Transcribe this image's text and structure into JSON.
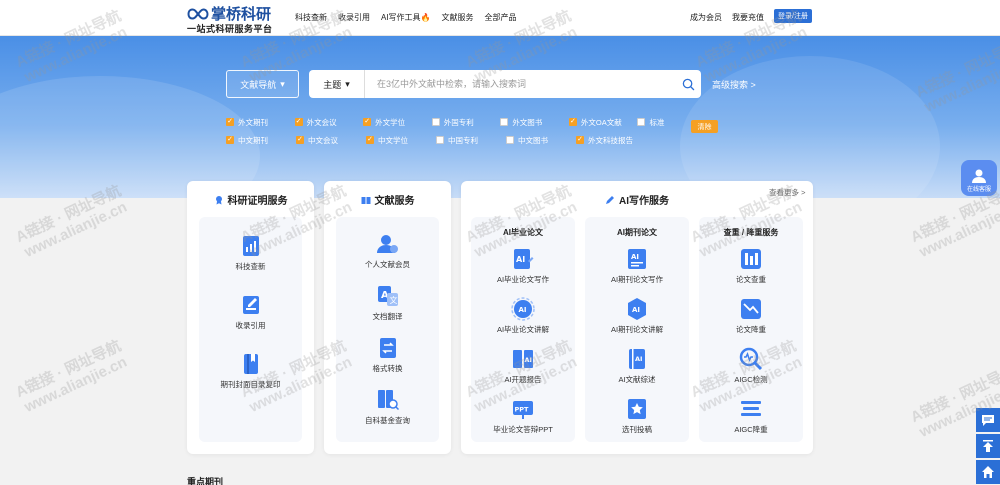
{
  "brand": {
    "name": "掌桥科研",
    "tagline": "一站式科研服务平台"
  },
  "nav": {
    "items": [
      "科技查新",
      "收录引用",
      "AI写作工具",
      "文献服务",
      "全部产品"
    ]
  },
  "top_right": {
    "member": "成为会员",
    "recharge": "我要充值",
    "login": "登录/注册"
  },
  "search": {
    "nav_select": "文献导航",
    "type_select": "主题",
    "placeholder": "在3亿中外文献中检索，请输入搜索词",
    "advanced": "高级搜索 >"
  },
  "filters": {
    "row1": [
      {
        "label": "外文期刊",
        "checked": true
      },
      {
        "label": "外文会议",
        "checked": true
      },
      {
        "label": "外文学位",
        "checked": true
      },
      {
        "label": "外国专利",
        "checked": false
      },
      {
        "label": "外文图书",
        "checked": false
      },
      {
        "label": "外文OA文献",
        "checked": true
      },
      {
        "label": "标准",
        "checked": false
      }
    ],
    "row2": [
      {
        "label": "中文期刊",
        "checked": true
      },
      {
        "label": "中文会议",
        "checked": true
      },
      {
        "label": "中文学位",
        "checked": true
      },
      {
        "label": "中国专利",
        "checked": false
      },
      {
        "label": "中文图书",
        "checked": false
      },
      {
        "label": "外文科技报告",
        "checked": true
      }
    ],
    "clear": "清除"
  },
  "panels": {
    "research": {
      "title": "科研证明服务",
      "items": [
        "科技查新",
        "收录引用",
        "期刊封面目录复印"
      ]
    },
    "literature": {
      "title": "文献服务",
      "items": [
        "个人文献会员",
        "文档翻译",
        "格式转换",
        "自科基金查询"
      ]
    },
    "ai": {
      "title": "AI写作服务",
      "more": "查看更多 >",
      "columns": [
        {
          "title": "AI毕业论文",
          "items": [
            "AI毕业论文写作",
            "AI毕业论文讲解",
            "AI开题报告",
            "毕业论文答辩PPT"
          ]
        },
        {
          "title": "AI期刊论文",
          "items": [
            "AI期刊论文写作",
            "AI期刊论文讲解",
            "AI文献综述",
            "选刊投稿"
          ]
        },
        {
          "title": "查重 / 降重服务",
          "items": [
            "论文查重",
            "论文降重",
            "AIGC检测",
            "AIGC降重"
          ]
        }
      ]
    }
  },
  "key_journals": "重点期刊",
  "float_service": "在线客服",
  "watermark": {
    "line1": "A链接 · 网址导航",
    "line2": "www.alianjie.cn"
  },
  "colors": {
    "primary": "#2b6fd6",
    "accent": "#f5a024",
    "hero_top": "#4a8fe6",
    "icon_blue": "#3d7ff0"
  }
}
